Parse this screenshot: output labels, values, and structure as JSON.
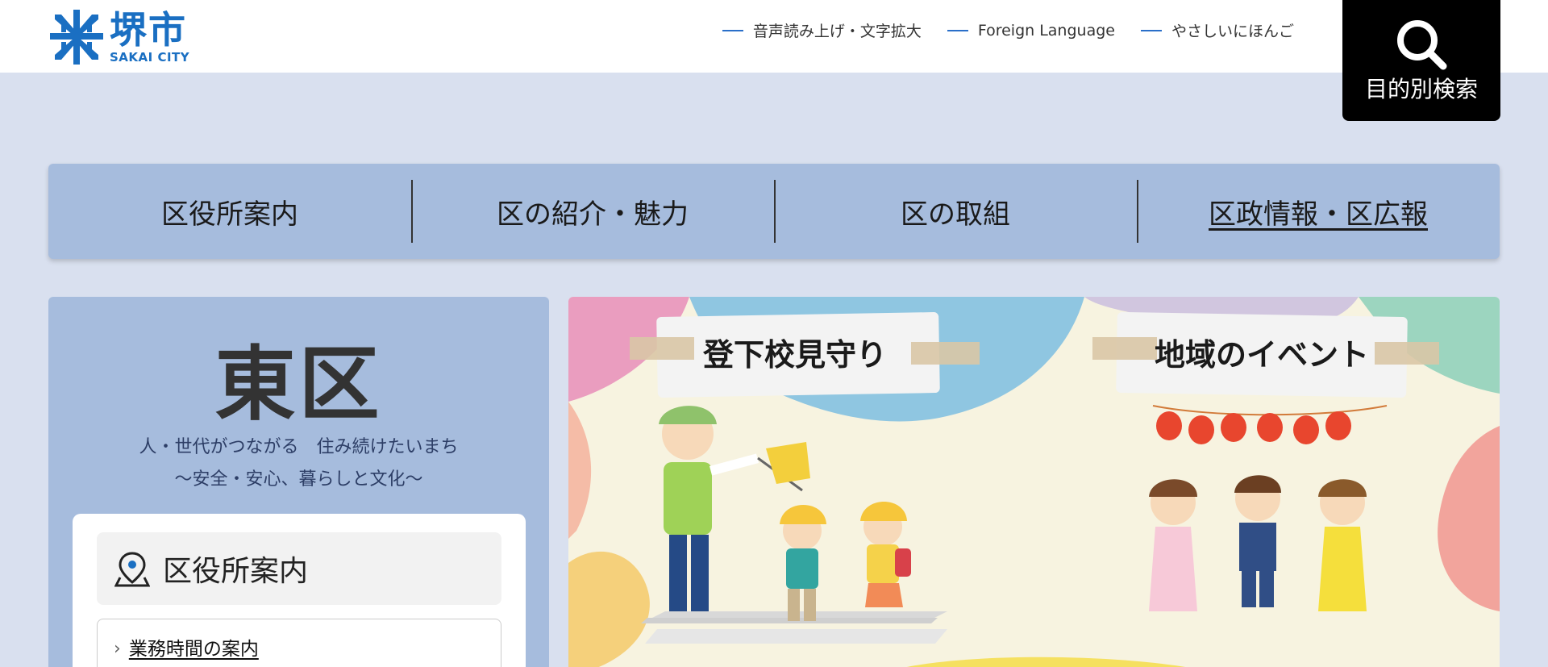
{
  "header": {
    "logo_text": "堺市",
    "logo_sub": "SAKAI CITY",
    "links": [
      {
        "label": "音声読み上げ・文字拡大"
      },
      {
        "label": "Foreign Language"
      },
      {
        "label": "やさしいにほんご"
      }
    ],
    "search_label": "目的別検索"
  },
  "nav": {
    "items": [
      {
        "label": "区役所案内"
      },
      {
        "label": "区の紹介・魅力"
      },
      {
        "label": "区の取組"
      },
      {
        "label": "区政情報・区広報"
      }
    ]
  },
  "left_panel": {
    "ward_name": "東区",
    "tagline_1": "人・世代がつながる　住み続けたいまち",
    "tagline_2": "～安全・安心、暮らしと文化～",
    "card_title": "区役所案内",
    "card_links": [
      {
        "label": "業務時間の案内"
      }
    ]
  },
  "banner": {
    "label_left": "登下校見守り",
    "label_right": "地域のイベント"
  },
  "colors": {
    "brand_blue": "#1a6fc2",
    "nav_bg": "#a6bcdd",
    "page_bg": "#d9e0ef",
    "search_bg": "#000000"
  }
}
